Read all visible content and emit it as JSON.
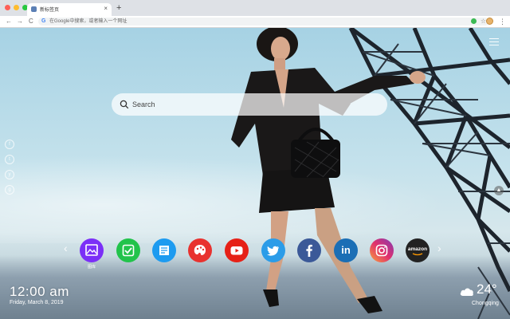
{
  "window": {
    "dots": [
      "#ff5f57",
      "#febc2e",
      "#28c840"
    ]
  },
  "tab": {
    "title": "新标签页",
    "close": "×",
    "new_tab": "+"
  },
  "toolbar": {
    "back": "←",
    "forward": "→",
    "reload": "C",
    "google_icon": "G",
    "omnibox_placeholder": "在Google中搜索，或者输入一个网址",
    "star": "☆",
    "menu": "⋮"
  },
  "search": {
    "placeholder": "Search"
  },
  "dock": {
    "prev": "‹",
    "next": "›",
    "apps": [
      {
        "name": "gallery",
        "label": "图库",
        "color": "#7b2ff7"
      },
      {
        "name": "tasks",
        "label": "",
        "color": "#22c34b"
      },
      {
        "name": "notes",
        "label": "",
        "color": "#1d9bf0"
      },
      {
        "name": "paint",
        "label": "",
        "color": "#e8322f"
      },
      {
        "name": "youtube",
        "label": "",
        "color": "#e62117"
      },
      {
        "name": "twitter",
        "label": "",
        "color": "#2b9ce8"
      },
      {
        "name": "facebook",
        "label": "",
        "color": "#3b5998"
      },
      {
        "name": "linkedin",
        "label": "in",
        "color": "#1b6eb5"
      },
      {
        "name": "instagram",
        "label": "",
        "color": "#d6249f"
      },
      {
        "name": "amazon",
        "label": "amazon",
        "color": "#222222"
      }
    ]
  },
  "side_icons": [
    "f",
    "t",
    "y",
    "g"
  ],
  "clock": {
    "time": "12:00 am",
    "date": "Friday, March 8, 2019"
  },
  "weather": {
    "temp": "24°",
    "city": "Chongqing"
  }
}
